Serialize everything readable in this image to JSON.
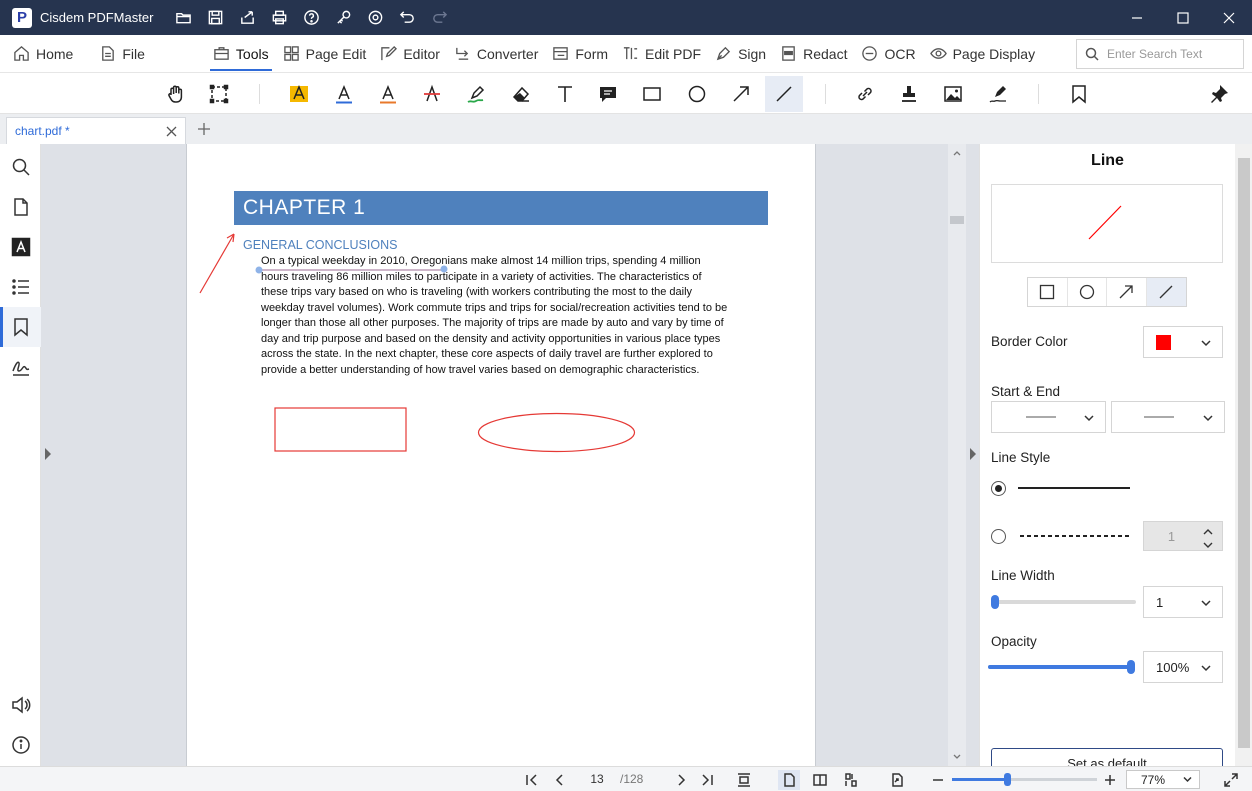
{
  "app": {
    "title": "Cisdem PDFMaster",
    "logo_letter": "P"
  },
  "menu": {
    "home": "Home",
    "file": "File",
    "tools": "Tools",
    "page_edit": "Page Edit",
    "editor": "Editor",
    "converter": "Converter",
    "form": "Form",
    "edit_pdf": "Edit PDF",
    "sign": "Sign",
    "redact": "Redact",
    "ocr": "OCR",
    "page_display": "Page Display",
    "active": "Tools"
  },
  "search": {
    "placeholder": "Enter Search Text"
  },
  "tab": {
    "label": "chart.pdf *"
  },
  "toolbar": {
    "selected_tool": "line-tool",
    "colors": {
      "highlight": "#f5b800",
      "underline": "#2f6bd8",
      "squiggly": "#e8792b",
      "strikeout": "#e03a3a",
      "pen": "#2aa84a"
    }
  },
  "document": {
    "chapter": "CHAPTER 1",
    "section": "GENERAL CONCLUSIONS",
    "lines": [
      "On a typical weekday in 2010, Oregonians make almost 14 million trips, spending 4 million",
      "hours traveling 86 million miles to participate in a variety of activities. The characteristics of",
      "these trips vary based on who is traveling (with workers contributing the most to the daily",
      "weekday travel volumes). Work commute trips and trips for social/recreation activities tend to be",
      "longer than those all other purposes. The majority of trips are made by auto and vary by time of",
      "day and trip purpose and based on the density and activity opportunities in various place types",
      "across the state. In the next chapter, these core aspects of daily travel are further explored to",
      "provide a better understanding of how travel varies based on demographic characteristics."
    ],
    "annotation_color": "#e53935",
    "heading_color": "#4f81bd"
  },
  "panel": {
    "title": "Line",
    "border_color_label": "Border Color",
    "border_color": "#ff0000",
    "start_end_label": "Start & End",
    "line_style_label": "Line Style",
    "line_style_selected": "solid",
    "dash_value": "1",
    "line_width_label": "Line Width",
    "line_width_value": "1",
    "line_width_level": 0,
    "opacity_label": "Opacity",
    "opacity_value": "100%",
    "opacity_level": 1.0,
    "set_default": "Set as default"
  },
  "status": {
    "page_current": "13",
    "page_total": "/128",
    "zoom": "77%",
    "zoom_level": 0.38
  }
}
